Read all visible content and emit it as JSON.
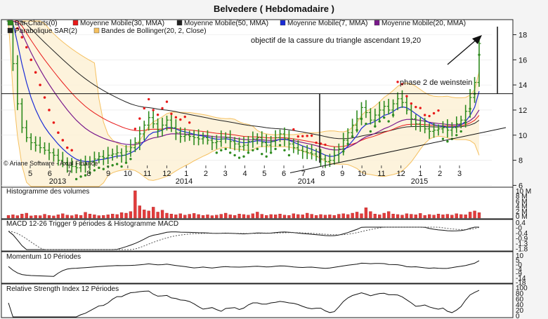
{
  "chart_data": {
    "type": "candlestick",
    "title": "Belvedere  ( Hebdomadaire )",
    "credit": "© Ariane Software - Axial Finance",
    "legend": [
      {
        "label": "Bar-Charts(0)",
        "color": "#2e8b1f"
      },
      {
        "label": "Moyenne Mobile(30, MMA)",
        "color": "#e81a1a"
      },
      {
        "label": "Moyenne Mobile(50, MMA)",
        "color": "#222222"
      },
      {
        "label": "Moyenne Mobile(7, MMA)",
        "color": "#1a2bd6"
      },
      {
        "label": "Moyenne Mobile(20, MMA)",
        "color": "#7a1a8c"
      },
      {
        "label": "Parabolique SAR(2)",
        "color": "#222222"
      },
      {
        "label": "Bandes de Bollinger(20, 2, Close)",
        "color": "#f5c060"
      }
    ],
    "annotations": {
      "target": "objectif de la cassure du triangle ascendant  19,20",
      "phase": "phase 2 de weinstein"
    },
    "x_month_ticks": [
      "5",
      "6",
      "7",
      "8",
      "9",
      "10",
      "11",
      "12",
      "1",
      "2",
      "3",
      "4",
      "5",
      "6",
      "7",
      "8",
      "9",
      "10",
      "11",
      "12",
      "1",
      "2",
      "3"
    ],
    "x_year_labels": [
      "2013",
      "2014",
      "2014",
      "2015"
    ],
    "y_ticks_price": [
      6,
      8,
      10,
      12,
      14,
      16,
      18
    ],
    "ylim_price": [
      5.8,
      19.2
    ],
    "horizontal_line": 13.3,
    "closes": [
      20.0,
      15.7,
      12.5,
      10.6,
      9.8,
      9.4,
      9.2,
      9.0,
      8.8,
      8.6,
      8.4,
      8.0,
      7.8,
      7.6,
      7.5,
      7.4,
      7.6,
      7.7,
      7.9,
      8.1,
      8.3,
      8.2,
      8.4,
      8.5,
      8.6,
      8.4,
      8.7,
      9.0,
      9.4,
      10.1,
      10.8,
      11.4,
      10.9,
      10.4,
      10.8,
      11.2,
      10.6,
      10.2,
      9.9,
      10.0,
      9.9,
      9.8,
      9.7,
      9.8,
      9.6,
      9.4,
      9.5,
      9.7,
      9.8,
      9.5,
      9.3,
      9.1,
      9.2,
      9.5,
      9.7,
      9.8,
      9.4,
      9.2,
      9.5,
      9.8,
      10.1,
      9.7,
      9.3,
      9.0,
      8.8,
      8.7,
      8.6,
      8.5,
      8.3,
      8.1,
      7.9,
      8.0,
      8.4,
      8.9,
      9.6,
      10.2,
      10.8,
      11.3,
      12.2,
      11.8,
      11.2,
      11.6,
      12.0,
      12.3,
      12.0,
      12.5,
      12.9,
      12.6,
      12.0,
      11.3,
      10.9,
      10.7,
      10.5,
      10.3,
      10.4,
      10.5,
      10.6,
      10.4,
      10.6,
      10.9,
      11.2,
      11.9,
      13.0,
      14.2,
      17.3
    ],
    "sar_top_values": [
      18.5,
      17.8,
      17.0,
      16.0,
      15.0,
      14.0,
      13.0,
      12.0,
      11.0,
      10.2,
      9.6,
      9.0,
      8.8
    ],
    "volume_ylabels": [
      "10 M",
      "8 M",
      "6 M",
      "4 M",
      "2 M",
      "0 M"
    ],
    "volume_max_m": 10,
    "volumes_m": [
      1.0,
      1.2,
      0.9,
      1.5,
      1.8,
      0.8,
      1.0,
      0.9,
      1.4,
      1.0,
      0.8,
      1.2,
      1.6,
      1.1,
      0.9,
      1.3,
      1.0,
      2.1,
      1.5,
      1.2,
      0.9,
      1.0,
      1.2,
      1.5,
      1.3,
      2.0,
      1.8,
      2.4,
      10.0,
      4.5,
      3.0,
      2.6,
      4.0,
      2.2,
      2.9,
      1.8,
      1.5,
      1.2,
      1.6,
      1.1,
      1.4,
      1.7,
      1.3,
      1.0,
      1.2,
      0.9,
      1.1,
      1.4,
      1.8,
      1.2,
      1.0,
      1.5,
      1.3,
      1.1,
      1.6,
      2.2,
      1.4,
      1.0,
      1.3,
      1.2,
      1.5,
      1.1,
      1.0,
      1.6,
      1.3,
      1.2,
      1.8,
      1.4,
      1.0,
      1.3,
      1.1,
      1.2,
      1.0,
      1.4,
      1.6,
      1.3,
      1.8,
      2.2,
      1.6,
      3.8,
      2.4,
      1.5,
      1.2,
      1.8,
      2.4,
      1.5,
      1.3,
      1.1,
      1.6,
      1.4,
      1.2,
      1.7,
      1.0,
      1.3,
      1.1,
      1.5,
      1.2,
      1.4,
      1.1,
      1.6,
      1.3,
      1.2,
      2.2,
      2.6,
      2.0
    ],
    "macd": {
      "title": "MACD 12-26   Trigger 9 périodes & Histogramme MACD",
      "y_ticks": [
        "0.4",
        "-0",
        "-0.4",
        "-0.9",
        "-1.3",
        "-1.8"
      ]
    },
    "momentum": {
      "title": "Momentum 10 Périodes",
      "y_ticks": [
        "10",
        "5",
        "-0",
        "-4",
        "-9",
        "-14",
        "-18"
      ]
    },
    "rsi": {
      "title": "Relative Strength Index 12 Périodes",
      "y_ticks": [
        "100",
        "80",
        "60",
        "40",
        "20",
        "0"
      ]
    }
  }
}
